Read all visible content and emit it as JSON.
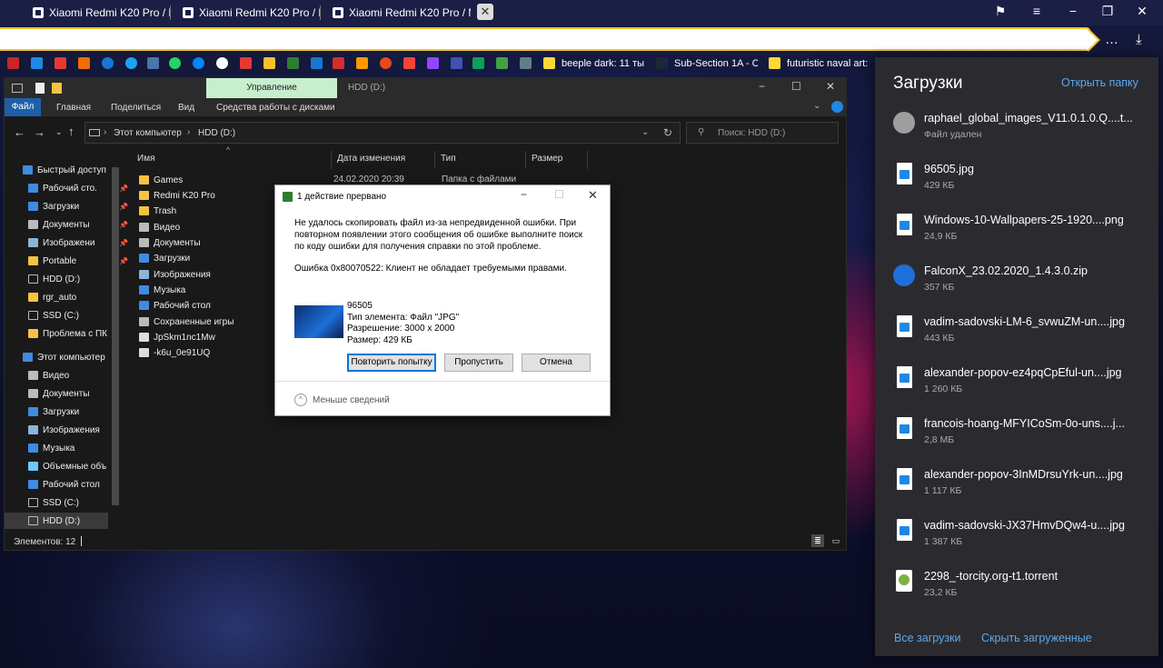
{
  "browser": {
    "tabs": [
      {
        "title": "Xiaomi Redmi K20 Pro / Mi"
      },
      {
        "title": "Xiaomi Redmi K20 Pro / Mi"
      },
      {
        "title": "Xiaomi Redmi K20 Pro / Mi"
      }
    ],
    "tab_close_glyph": "✕",
    "bookmarks": [
      {
        "label": "beeple dark: 11 ты"
      },
      {
        "label": "Sub-Section 1A - C"
      },
      {
        "label": "futuristic naval art:"
      }
    ]
  },
  "explorer": {
    "ribbon_context_tab": "Управление",
    "window_title": "HDD (D:)",
    "menu": [
      "Файл",
      "Главная",
      "Поделиться",
      "Вид",
      "Средства работы с дисками"
    ],
    "path": [
      "Этот компьютер",
      "HDD (D:)"
    ],
    "search_placeholder": "Поиск: HDD (D:)",
    "nav_items": [
      "Быстрый доступ",
      "Рабочий сто.",
      "Загрузки",
      "Документы",
      "Изображени",
      "Portable",
      "HDD (D:)",
      "rgr_auto",
      "SSD (C:)",
      "Проблема с ПК",
      "Этот компьютер",
      "Видео",
      "Документы",
      "Загрузки",
      "Изображения",
      "Музыка",
      "Объемные объ",
      "Рабочий стол",
      "SSD (C:)",
      "HDD (D:)"
    ],
    "columns": [
      "Имя",
      "Дата изменения",
      "Тип",
      "Размер"
    ],
    "first_row": {
      "date": "24.02.2020 20:39",
      "type": "Папка с файлами"
    },
    "files": [
      "Games",
      "Redmi K20 Pro",
      "Trash",
      "Видео",
      "Документы",
      "Загрузки",
      "Изображения",
      "Музыка",
      "Рабочий стол",
      "Сохраненные игры",
      "JpSkm1nc1Mw",
      "-k6u_0e91UQ"
    ],
    "status": "Элементов: 12"
  },
  "dialog": {
    "title": "1 действие прервано",
    "message": "Не удалось скопировать файл из-за непредвиденной ошибки. При повторном появлении этого сообщения об ошибке выполните поиск по коду ошибки для получения справки по этой проблеме.",
    "error": "Ошибка 0x80070522: Клиент не обладает требуемыми правами.",
    "file_name": "96505",
    "file_type": "Тип элемента: Файл \"JPG\"",
    "file_resolution": "Разрешение: 3000 x 2000",
    "file_size": "Размер: 429 КБ",
    "retry": "Повторить попытку",
    "skip": "Пропустить",
    "cancel": "Отмена",
    "less_details": "Меньше сведений"
  },
  "downloads": {
    "title": "Загрузки",
    "open_folder": "Открыть папку",
    "items": [
      {
        "name": "raphael_global_images_V11.0.1.0.Q....t...",
        "meta": "Файл удален",
        "icon": "tgz-archive-icon"
      },
      {
        "name": "96505.jpg",
        "meta": "429 КБ",
        "icon": "image-file-icon"
      },
      {
        "name": "Windows-10-Wallpapers-25-1920....png",
        "meta": "24,9 КБ",
        "icon": "image-file-icon"
      },
      {
        "name": "FalconX_23.02.2020_1.4.3.0.zip",
        "meta": "357 КБ",
        "icon": "zip-archive-icon"
      },
      {
        "name": "vadim-sadovski-LM-6_svwuZM-un....jpg",
        "meta": "443 КБ",
        "icon": "image-file-icon"
      },
      {
        "name": "alexander-popov-ez4pqCpEful-un....jpg",
        "meta": "1 260 КБ",
        "icon": "image-file-icon"
      },
      {
        "name": "francois-hoang-MFYICoSm-0o-uns....j...",
        "meta": "2,8 МБ",
        "icon": "image-file-icon"
      },
      {
        "name": "alexander-popov-3InMDrsuYrk-un....jpg",
        "meta": "1 117 КБ",
        "icon": "image-file-icon"
      },
      {
        "name": "vadim-sadovski-JX37HmvDQw4-u....jpg",
        "meta": "1 387 КБ",
        "icon": "image-file-icon"
      },
      {
        "name": "2298_-torcity.org-t1.torrent",
        "meta": "23,2 КБ",
        "icon": "torrent-file-icon"
      }
    ],
    "all_downloads": "Все загрузки",
    "hide_downloaded": "Скрыть загруженные"
  },
  "colors": {
    "address_border": "#f1c232",
    "ribbon_context": "#c6efce",
    "link": "#5aa9f0",
    "folder": "#f5c342",
    "download_panel": "#2b2b2f"
  }
}
